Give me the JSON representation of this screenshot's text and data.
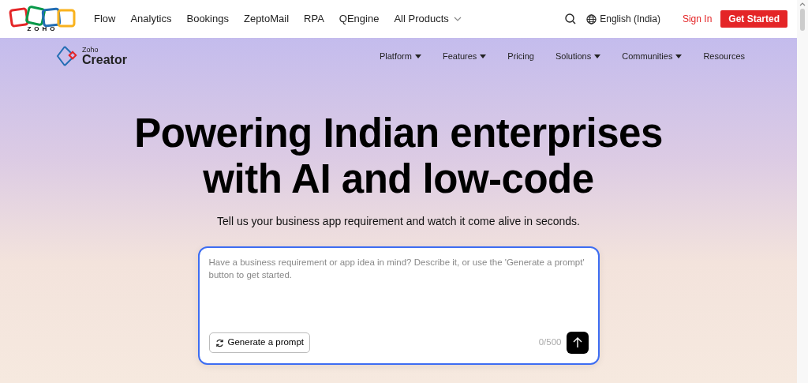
{
  "top_bar": {
    "logo_text": "ZOHO",
    "links": [
      {
        "label": "Flow",
        "has_menu": false
      },
      {
        "label": "Analytics",
        "has_menu": false
      },
      {
        "label": "Bookings",
        "has_menu": false
      },
      {
        "label": "ZeptoMail",
        "has_menu": false
      },
      {
        "label": "RPA",
        "has_menu": false
      },
      {
        "label": "QEngine",
        "has_menu": false
      },
      {
        "label": "All Products",
        "has_menu": true
      }
    ],
    "language": "English (India)",
    "sign_in": "Sign In",
    "get_started": "Get Started"
  },
  "product_nav": {
    "brand_small": "Zoho",
    "brand_name": "Creator",
    "items": [
      {
        "label": "Platform",
        "has_menu": true
      },
      {
        "label": "Features",
        "has_menu": true
      },
      {
        "label": "Pricing",
        "has_menu": false
      },
      {
        "label": "Solutions",
        "has_menu": true
      },
      {
        "label": "Communities",
        "has_menu": true
      },
      {
        "label": "Resources",
        "has_menu": false
      }
    ]
  },
  "hero": {
    "headline_lines": [
      "Powering Indian enterprises",
      "with AI and low-code"
    ],
    "subtitle": "Tell us your business app requirement and watch it come alive in seconds.",
    "prompt": {
      "placeholder": "Have a business requirement or app idea in mind? Describe it, or use the 'Generate a prompt' button to get started.",
      "generate_button": "Generate a prompt",
      "counter": "0/500"
    }
  }
}
